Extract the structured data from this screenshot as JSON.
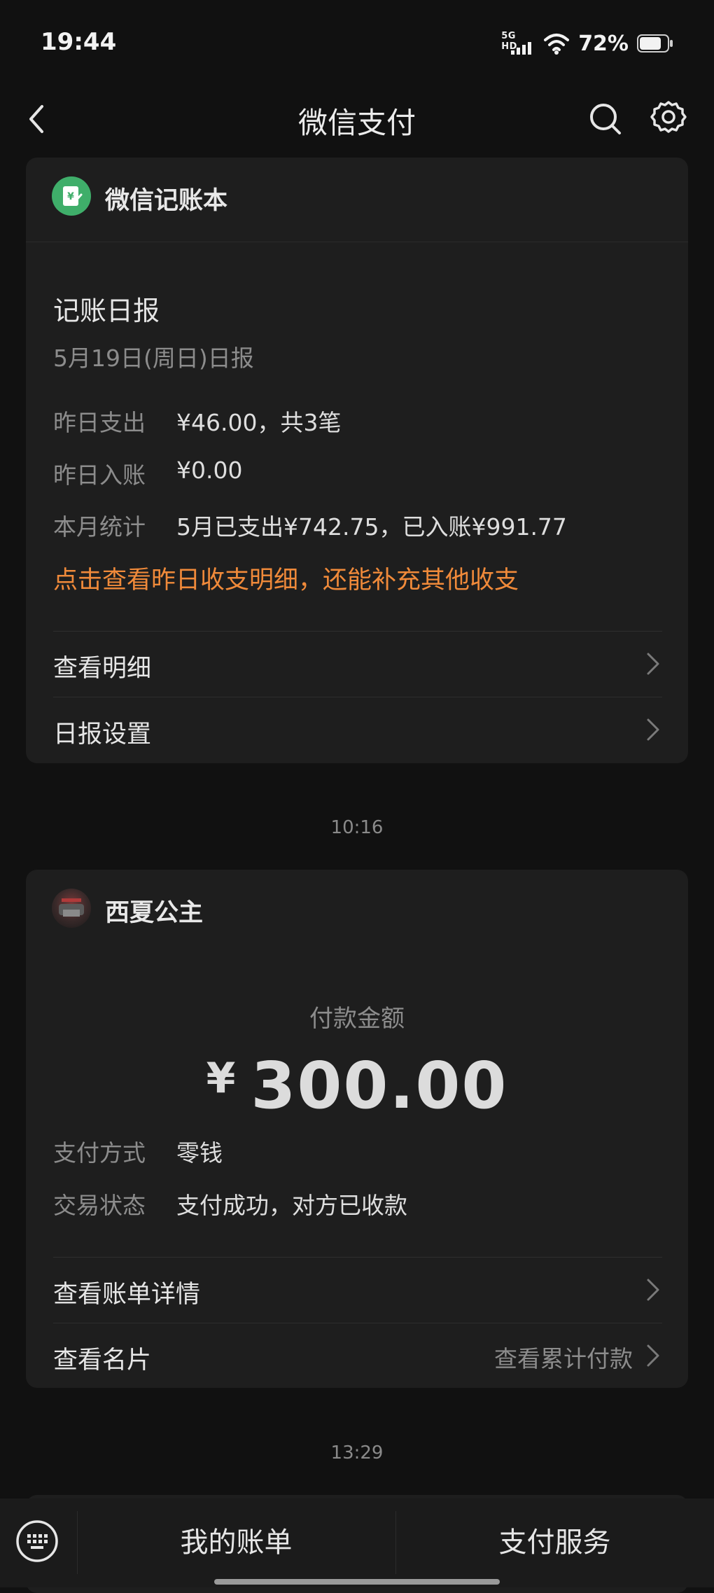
{
  "status_bar": {
    "time": "19:44",
    "network": "5G HD",
    "battery": "72%",
    "icons": [
      "signal-icon",
      "wifi-icon",
      "battery-icon"
    ]
  },
  "header": {
    "title": "微信支付",
    "back_icon": "back-arrow-icon",
    "search_icon": "search-icon",
    "settings_icon": "gear-icon"
  },
  "ledger_card": {
    "name": "微信记账本",
    "icon": "ledger-icon",
    "report_title": "记账日报",
    "report_date": "5月19日(周日)日报",
    "rows": [
      {
        "label": "昨日支出",
        "value": "¥46.00，共3笔"
      },
      {
        "label": "昨日入账",
        "value": "¥0.00"
      },
      {
        "label": "本月统计",
        "value": "5月已支出¥742.75，已入账¥991.77"
      }
    ],
    "cta": "点击查看昨日收支明细，还能补充其他收支",
    "actions": [
      {
        "label": "查看明细"
      },
      {
        "label": "日报设置"
      }
    ]
  },
  "timestamps": [
    "10:16",
    "13:29"
  ],
  "payment_card": {
    "name": "西夏公主",
    "amount_label": "付款金额",
    "currency": "¥",
    "amount": "300.00",
    "details": [
      {
        "label": "支付方式",
        "value": "零钱"
      },
      {
        "label": "交易状态",
        "value": "支付成功，对方已收款"
      }
    ],
    "actions": [
      {
        "label": "查看账单详情",
        "right": ""
      },
      {
        "label": "查看名片",
        "right": "查看累计付款"
      }
    ]
  },
  "bottom_bar": {
    "keyboard_icon": "keyboard-icon",
    "tabs": [
      {
        "label": "我的账单"
      },
      {
        "label": "支付服务"
      }
    ]
  },
  "colors": {
    "background": "#111111",
    "card": "#1e1e1e",
    "accent_orange": "#f08a3a",
    "ledger_green": "#3fae6a"
  }
}
